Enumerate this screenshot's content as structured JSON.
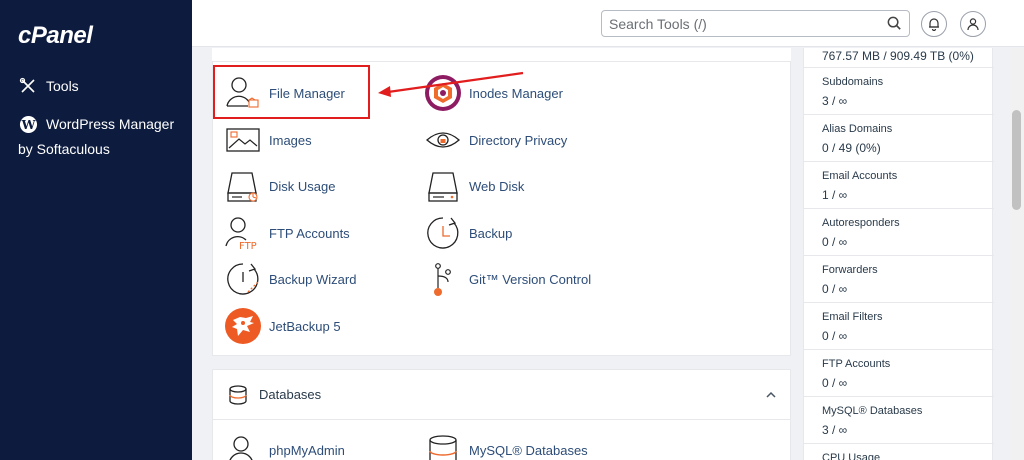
{
  "sidebar": {
    "logo": "cPanel",
    "items": [
      {
        "label": "Tools"
      },
      {
        "label": "WordPress Manager"
      }
    ],
    "wp_sub": "by Softaculous"
  },
  "header": {
    "search_placeholder": "Search Tools (/)"
  },
  "files_tools": [
    {
      "label": "File Manager",
      "icon": "file-manager-icon"
    },
    {
      "label": "Inodes Manager",
      "icon": "inodes-manager-icon"
    },
    {
      "label": "Images",
      "icon": "images-icon"
    },
    {
      "label": "Directory Privacy",
      "icon": "directory-privacy-icon"
    },
    {
      "label": "Disk Usage",
      "icon": "disk-usage-icon"
    },
    {
      "label": "Web Disk",
      "icon": "web-disk-icon"
    },
    {
      "label": "FTP Accounts",
      "icon": "ftp-accounts-icon"
    },
    {
      "label": "Backup",
      "icon": "backup-icon"
    },
    {
      "label": "Backup Wizard",
      "icon": "backup-wizard-icon"
    },
    {
      "label": "Git™ Version Control",
      "icon": "git-icon"
    },
    {
      "label": "JetBackup 5",
      "icon": "jetbackup-icon"
    }
  ],
  "databases": {
    "title": "Databases",
    "tools": [
      {
        "label": "phpMyAdmin",
        "icon": "phpmyadmin-icon"
      },
      {
        "label": "MySQL® Databases",
        "icon": "mysql-databases-icon"
      }
    ]
  },
  "stats": {
    "top_value": "767.57 MB / 909.49 TB   (0%)",
    "rows": [
      {
        "label": "Subdomains",
        "value": "3 / ∞"
      },
      {
        "label": "Alias Domains",
        "value": "0 / 49   (0%)"
      },
      {
        "label": "Email Accounts",
        "value": "1 / ∞"
      },
      {
        "label": "Autoresponders",
        "value": "0 / ∞"
      },
      {
        "label": "Forwarders",
        "value": "0 / ∞"
      },
      {
        "label": "Email Filters",
        "value": "0 / ∞"
      },
      {
        "label": "FTP Accounts",
        "value": "0 / ∞"
      },
      {
        "label": "MySQL® Databases",
        "value": "3 / ∞"
      },
      {
        "label": "CPU Usage",
        "value": ""
      }
    ]
  },
  "colors": {
    "sidebar_bg": "#0d1b3e",
    "link": "#2d4d78",
    "accent_orange": "#ee6a2d",
    "highlight_red": "#e21d1d"
  }
}
